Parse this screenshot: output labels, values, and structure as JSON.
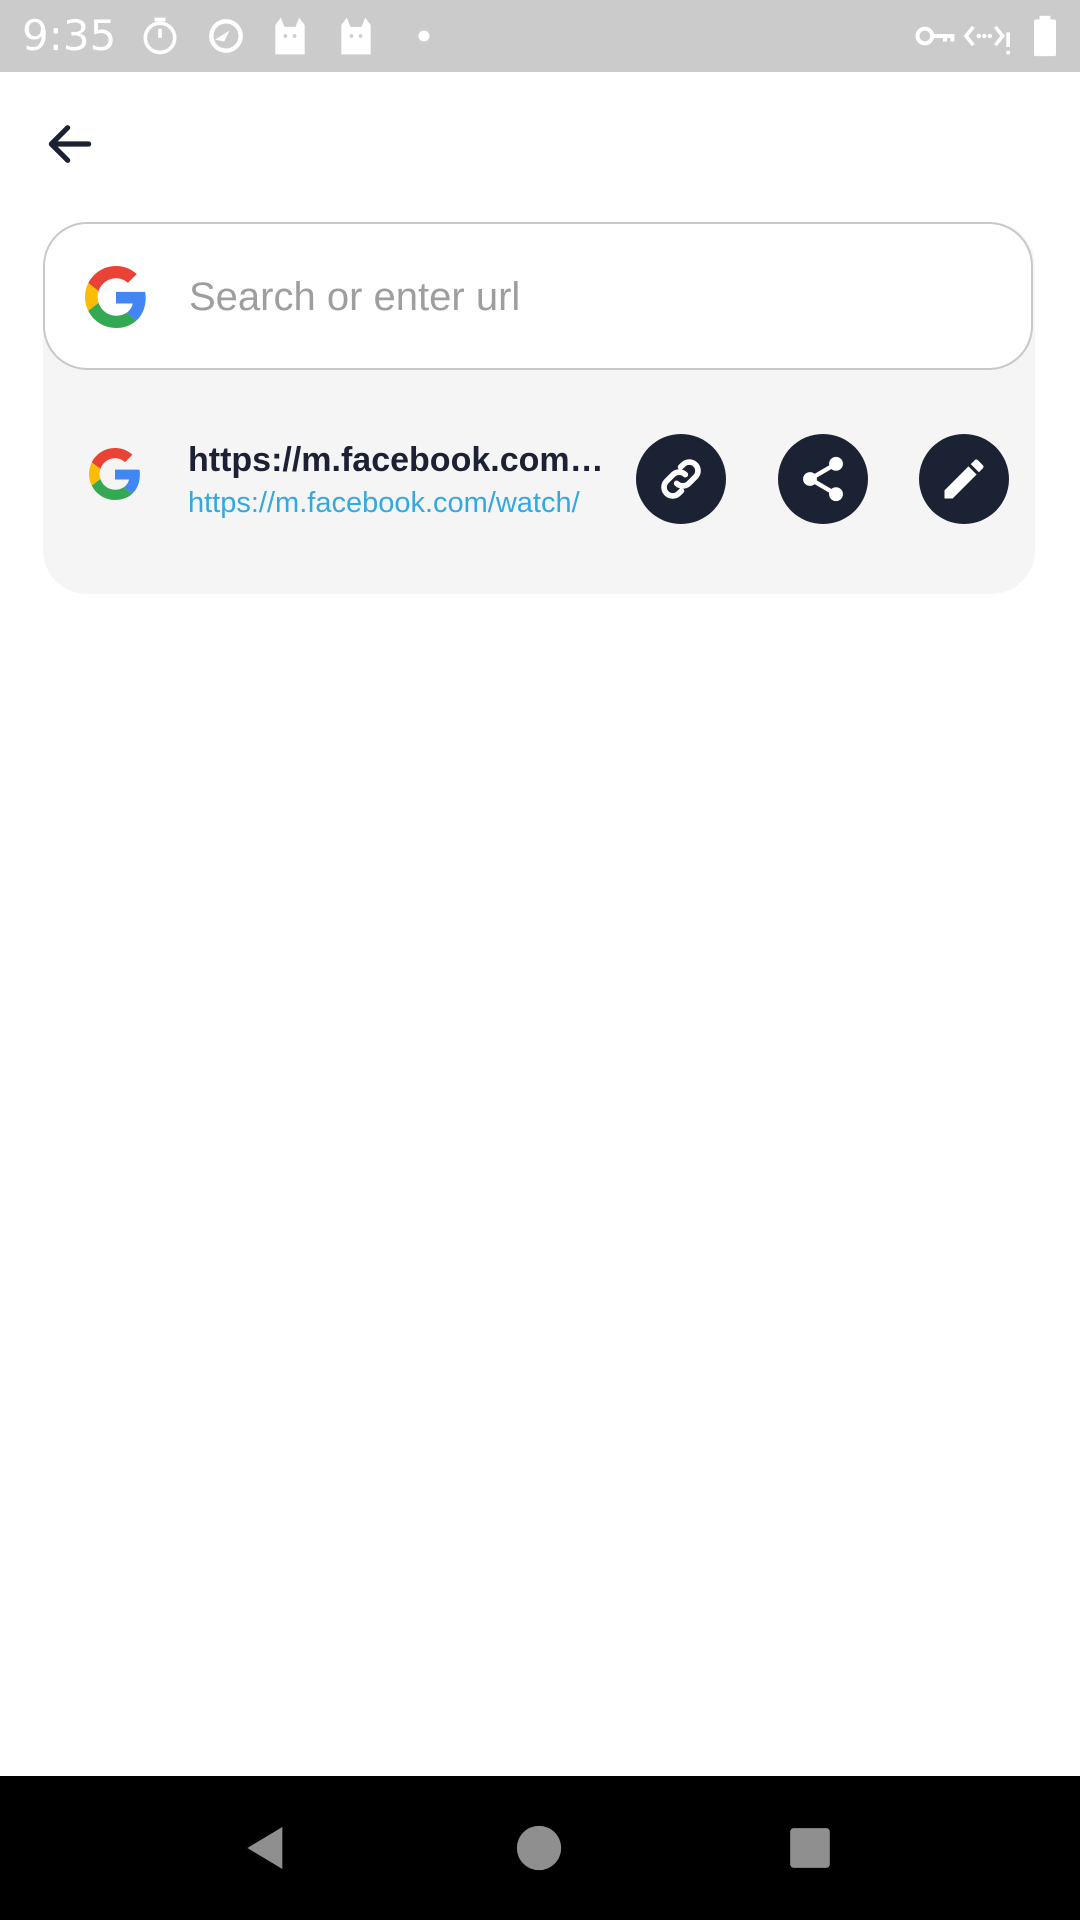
{
  "status_bar": {
    "time": "9:35",
    "icons": [
      "timer-icon",
      "data-saver-icon",
      "cat-icon",
      "cat-icon",
      "dot-icon",
      "vpn-key-icon",
      "network-icon",
      "battery-icon"
    ]
  },
  "header": {
    "back_icon": "arrow-left-icon"
  },
  "search": {
    "placeholder": "Search or enter url",
    "value": "",
    "engine_icon": "google-icon"
  },
  "suggestions": [
    {
      "title": "https://m.facebook.com/watch/",
      "url": "https://m.facebook.com/watch/",
      "icon": "google-icon",
      "actions": [
        "link-icon",
        "share-icon",
        "edit-icon"
      ]
    }
  ],
  "nav_bar": {
    "buttons": [
      "back-triangle-icon",
      "home-circle-icon",
      "recents-square-icon"
    ]
  },
  "colors": {
    "status_bar_bg": "#cbcbcb",
    "panel_bg": "#f5f5f5",
    "action_button_bg": "#1b2233",
    "suggestion_title": "#1c2233",
    "suggestion_url": "#35a8e0",
    "placeholder": "#9e9e9e",
    "nav_bar_bg": "#000000"
  }
}
